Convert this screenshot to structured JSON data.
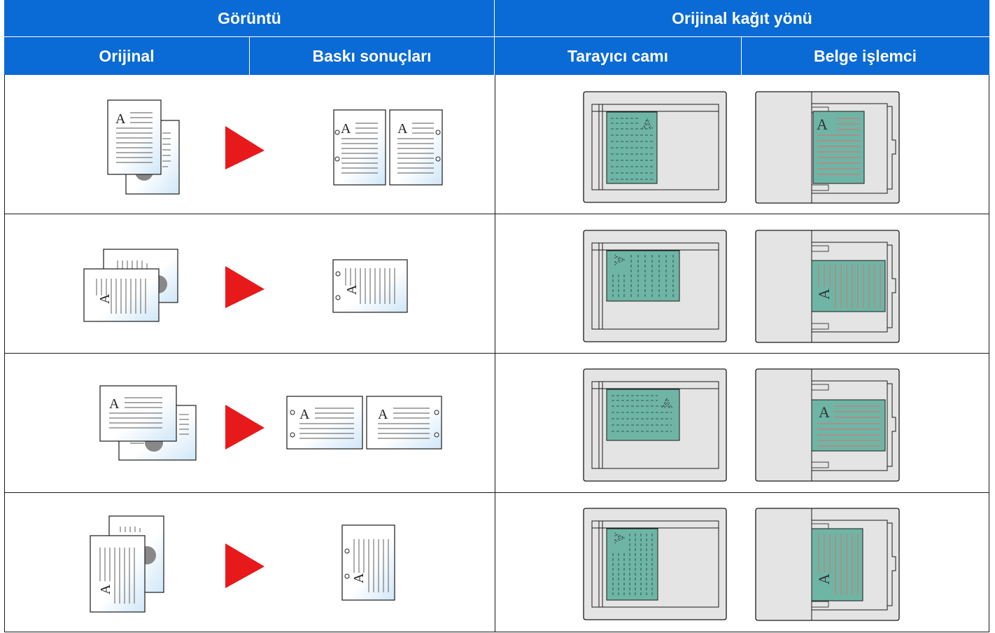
{
  "header": {
    "group_image": "Görüntü",
    "group_orientation": "Orijinal kağıt yönü",
    "col_original": "Orijinal",
    "col_print_results": "Baskı sonuçları",
    "col_scanner_glass": "Tarayıcı camı",
    "col_document_processor": "Belge işlemci"
  },
  "icons": {
    "arrow": "red-right-arrow-icon",
    "original": "stacked-pages-icon",
    "result": "punched-page-icon",
    "glass": "scanner-glass-icon",
    "processor": "document-processor-icon"
  },
  "colors": {
    "header_bg": "#0a6ad6",
    "header_text": "#ffffff",
    "arrow": "#e8191b",
    "scan_sheet": "#6fb5a5",
    "device_gray": "#e4e4e4"
  },
  "rows": [
    {
      "name": "portrait-2-sheets",
      "page_letter": "A",
      "orientation": "portrait",
      "sheets": 2
    },
    {
      "name": "landscape-1-sheet",
      "page_letter": "A",
      "orientation": "landscape-rotated",
      "sheets": 1
    },
    {
      "name": "landscape-2-sheets",
      "page_letter": "A",
      "orientation": "landscape",
      "sheets": 2
    },
    {
      "name": "portrait-1-sheet",
      "page_letter": "A",
      "orientation": "portrait-rotated",
      "sheets": 1
    }
  ]
}
